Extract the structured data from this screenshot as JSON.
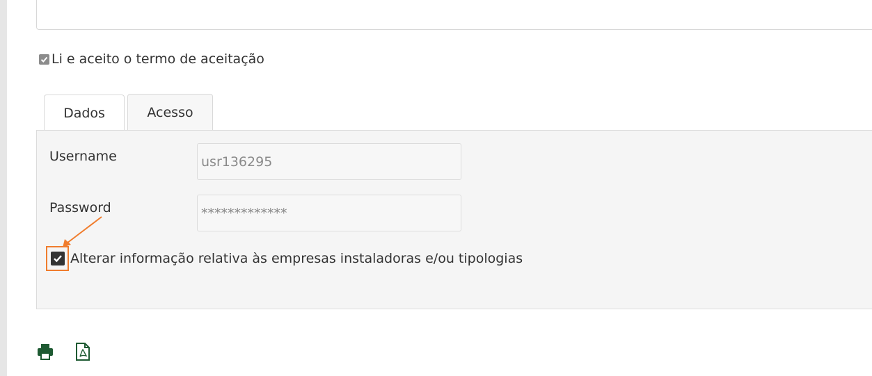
{
  "terms": {
    "label": "Li e aceito o termo de aceitação",
    "checked": true
  },
  "tabs": [
    {
      "label": "Dados",
      "active": false
    },
    {
      "label": "Acesso",
      "active": true
    }
  ],
  "access": {
    "username_label": "Username",
    "username_value": "usr136295",
    "password_label": "Password",
    "password_value": "*************",
    "alter_checkbox_label": "Alterar informação relativa às empresas instaladoras e/ou tipologias",
    "alter_checked": true
  },
  "toolbar": {
    "icons": [
      "print-icon",
      "pdf-icon"
    ]
  },
  "colors": {
    "accent_orange": "#f07d2e",
    "icon_green": "#1e5a32",
    "checkbox_dark": "#333333"
  }
}
